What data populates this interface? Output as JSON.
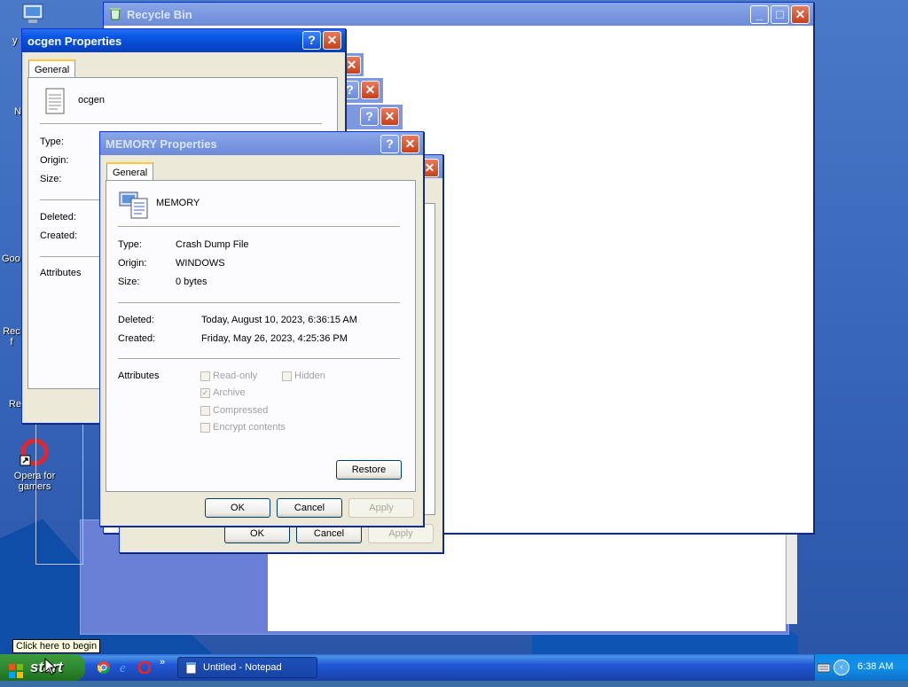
{
  "desktop": {
    "icons": [
      {
        "label": "Opera for gamers",
        "icon": "opera-gx-icon"
      }
    ],
    "partial_labels": [
      "y",
      "N",
      "Goo",
      "Rec f",
      "Re"
    ]
  },
  "recycle_bin": {
    "title": "Recycle Bin"
  },
  "ocgen_dialog": {
    "title": "ocgen Properties",
    "tab": "General",
    "filename": "ocgen",
    "type_label": "Type:",
    "origin_label": "Origin:",
    "size_label": "Size:",
    "deleted_label": "Deleted:",
    "created_label": "Created:",
    "attributes_label": "Attributes"
  },
  "back_dialog": {
    "ok": "OK",
    "cancel": "Cancel",
    "apply": "Apply"
  },
  "memory_dialog": {
    "title": "MEMORY Properties",
    "tab": "General",
    "filename": "MEMORY",
    "type_label": "Type:",
    "type_value": "Crash Dump File",
    "origin_label": "Origin:",
    "origin_value": "WINDOWS",
    "size_label": "Size:",
    "size_value": "0 bytes",
    "deleted_label": "Deleted:",
    "deleted_value": "Today, August 10, 2023, 6:36:15 AM",
    "created_label": "Created:",
    "created_value": "Friday, May 26, 2023, 4:25:36 PM",
    "attributes_label": "Attributes",
    "attributes": {
      "read_only": "Read-only",
      "hidden": "Hidden",
      "archive": "Archive",
      "compressed": "Compressed",
      "encrypt": "Encrypt contents"
    },
    "restore": "Restore",
    "ok": "OK",
    "cancel": "Cancel",
    "apply": "Apply"
  },
  "taskbar": {
    "start": "start",
    "tooltip": "Click here to begin",
    "task_button": "Untitled - Notepad",
    "clock": "6:38 AM",
    "quicklaunch": [
      "chrome-icon",
      "ie-icon",
      "opera-icon"
    ]
  }
}
